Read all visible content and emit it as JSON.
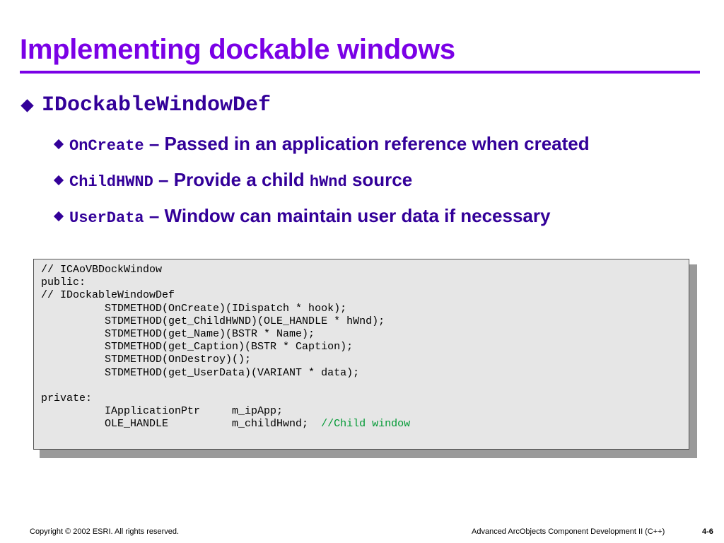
{
  "title": "Implementing dockable windows",
  "bullet_main": "IDockableWindowDef",
  "bullets": [
    {
      "code": "OnCreate",
      "text": " – Passed in an application reference when created"
    },
    {
      "code": "ChildHWND",
      "text": " – Provide a child ",
      "code2": "hWnd",
      "text2": " source"
    },
    {
      "code": "UserData",
      "text": " – Window can maintain user data if necessary"
    }
  ],
  "code_lines": [
    "// ICAoVBDockWindow",
    "public:",
    "// IDockableWindowDef",
    "          STDMETHOD(OnCreate)(IDispatch * hook);",
    "          STDMETHOD(get_ChildHWND)(OLE_HANDLE * hWnd);",
    "          STDMETHOD(get_Name)(BSTR * Name);",
    "          STDMETHOD(get_Caption)(BSTR * Caption);",
    "          STDMETHOD(OnDestroy)();",
    "          STDMETHOD(get_UserData)(VARIANT * data);",
    "",
    "private:",
    "          IApplicationPtr     m_ipApp;",
    "          OLE_HANDLE          m_childHwnd;  "
  ],
  "code_comment": "//Child window",
  "footer": {
    "copyright": "Copyright © 2002 ESRI. All rights reserved.",
    "course": "Advanced ArcObjects Component Development II (C++)",
    "page": "4-6"
  },
  "colors": {
    "title": "#7a00e6",
    "bullet_text": "#330099",
    "code_comment": "#009933",
    "code_background": "#e6e6e6"
  }
}
